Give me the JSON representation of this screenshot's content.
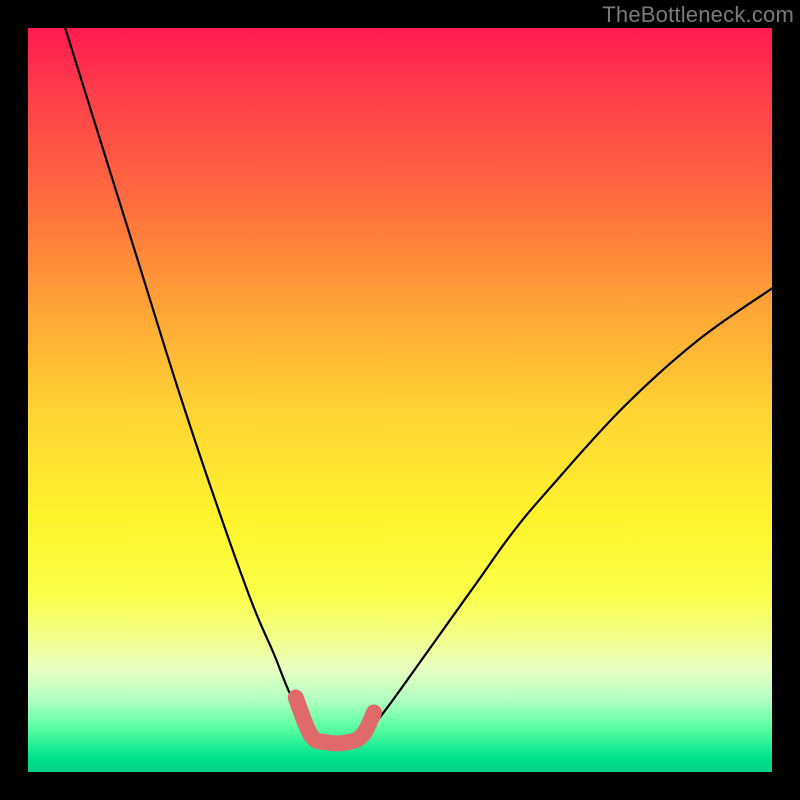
{
  "watermark": "TheBottleneck.com",
  "chart_data": {
    "type": "line",
    "title": "",
    "xlabel": "",
    "ylabel": "",
    "xlim": [
      0,
      100
    ],
    "ylim": [
      0,
      100
    ],
    "series": [
      {
        "name": "left-curve",
        "x": [
          5,
          10,
          15,
          20,
          25,
          30,
          33,
          35,
          37,
          38.5
        ],
        "values": [
          100,
          84,
          68,
          52,
          37,
          23,
          16,
          11,
          7,
          5
        ]
      },
      {
        "name": "right-curve",
        "x": [
          45,
          47,
          50,
          55,
          60,
          65,
          70,
          80,
          90,
          100
        ],
        "values": [
          5,
          7,
          11,
          18,
          25,
          32,
          38,
          49,
          58,
          65
        ]
      },
      {
        "name": "highlight-segment",
        "x": [
          36,
          38,
          40,
          43,
          45,
          46.5
        ],
        "values": [
          10,
          5,
          4,
          4,
          5,
          8
        ]
      }
    ],
    "colors": {
      "curve": "#000000",
      "highlight": "#e06a6a"
    },
    "gradient_stops": [
      {
        "pos": 0,
        "color": "#ff1a51"
      },
      {
        "pos": 50,
        "color": "#ffe933"
      },
      {
        "pos": 92,
        "color": "#7cffb0"
      },
      {
        "pos": 100,
        "color": "#00d083"
      }
    ]
  }
}
